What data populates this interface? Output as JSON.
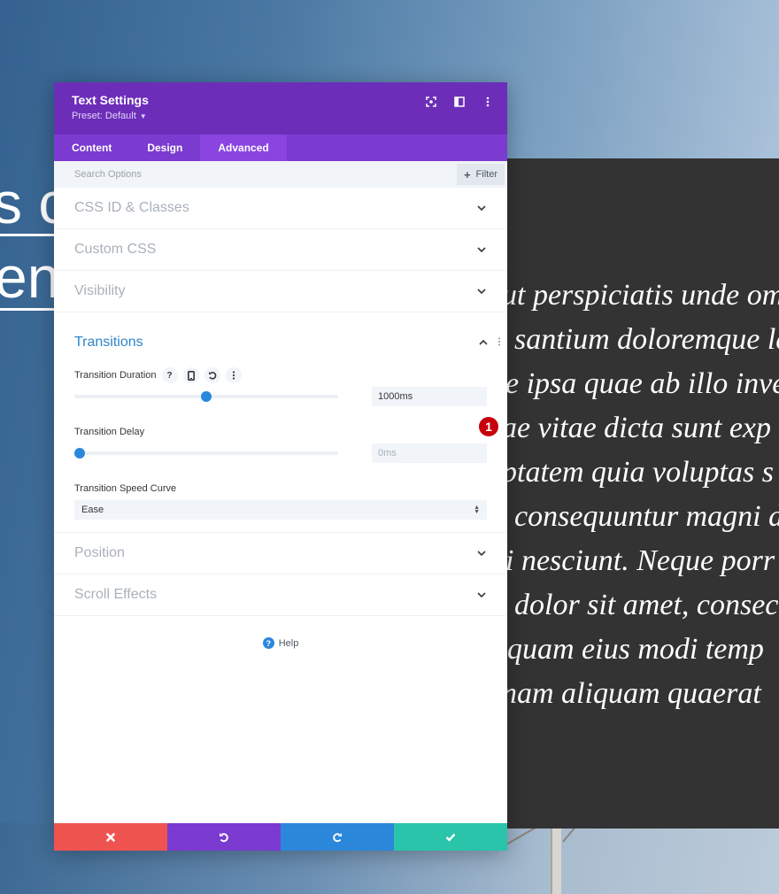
{
  "background": {
    "hero_lines": [
      "s c",
      "en"
    ],
    "quote_lines": [
      "ut perspiciatis unde om",
      "santium doloremque la",
      "e ipsa quae ab illo inve",
      "ae vitae dicta sunt exp",
      "ptatem quia voluptas s",
      "consequuntur magni d",
      "i nesciunt. Neque porr",
      "dolor sit amet, consec",
      "quam eius modi temp",
      "nam aliquam quaerat"
    ]
  },
  "panel": {
    "title": "Text Settings",
    "preset": "Preset: Default",
    "header_icons": [
      "expand-icon",
      "split-view-icon",
      "more-options-icon"
    ],
    "tabs": [
      {
        "label": "Content",
        "active": false
      },
      {
        "label": "Design",
        "active": false
      },
      {
        "label": "Advanced",
        "active": true
      }
    ],
    "search": {
      "placeholder": "Search Options",
      "filter_label": "Filter"
    },
    "sections_top": [
      {
        "title": "CSS ID & Classes"
      },
      {
        "title": "Custom CSS"
      },
      {
        "title": "Visibility"
      }
    ],
    "transitions": {
      "title": "Transitions",
      "duration": {
        "label": "Transition Duration",
        "value": "1000ms",
        "slider_fraction": 0.5,
        "badge": "1"
      },
      "delay": {
        "label": "Transition Delay",
        "placeholder": "0ms",
        "slider_fraction": 0.0
      },
      "speed_curve": {
        "label": "Transition Speed Curve",
        "selected": "Ease"
      }
    },
    "sections_bottom": [
      {
        "title": "Position"
      },
      {
        "title": "Scroll Effects"
      }
    ],
    "help_label": "Help",
    "footer": {
      "colors": {
        "cancel": "#ef5350",
        "undo": "#7b3ad0",
        "redo": "#2b87da",
        "save": "#29c4a9"
      }
    }
  }
}
